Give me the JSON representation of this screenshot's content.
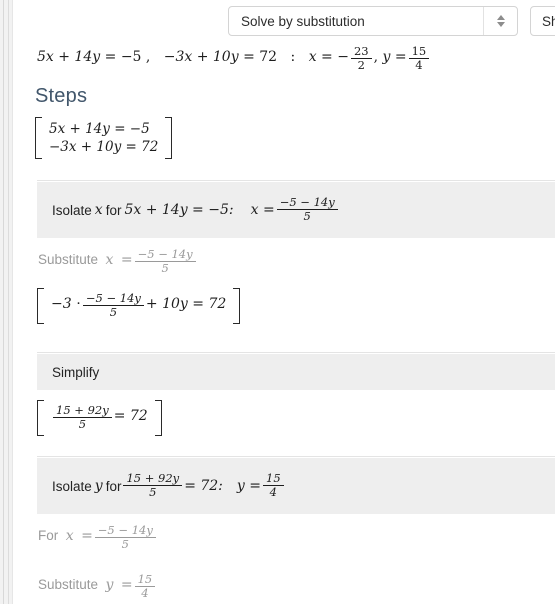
{
  "toolbar": {
    "method_select": {
      "value": "Solve by substitution",
      "stepper_up_icon": "triangle-up-icon",
      "stepper_down_icon": "triangle-down-icon"
    },
    "show_button_label": "Sho"
  },
  "query": {
    "eq1_lhs": "5x + 14y",
    "eq1_rhs": "−5",
    "eq2_lhs": "−3x + 10y",
    "eq2_rhs": "72",
    "separator": ":",
    "sol_x_label": "x =",
    "sol_x_sign": "−",
    "sol_x_num": "23",
    "sol_x_den": "2",
    "sol_y_label": "y =",
    "sol_y_num": "15",
    "sol_y_den": "4",
    "comma": ","
  },
  "steps": {
    "heading": "Steps",
    "system": {
      "row1": "5x + 14y =  −5",
      "row2": "−3x + 10y = 72"
    },
    "items": [
      {
        "kind": "band",
        "name": "isolate-x-step",
        "prefix": "Isolate",
        "var": "x",
        "mid": "for",
        "equation": "5x + 14y = −5:",
        "result_label": "x =",
        "result_num": "−5 − 14y",
        "result_den": "5"
      },
      {
        "kind": "plain",
        "name": "substitute-x-step",
        "prefix": "Substitute",
        "var": "x",
        "eq": "=",
        "num": "−5 − 14y",
        "den": "5"
      },
      {
        "kind": "bracket",
        "name": "substituted-equation",
        "lead": "−3 ⋅",
        "num": "−5 − 14y",
        "den": "5",
        "tail": "+ 10y = 72"
      },
      {
        "kind": "band",
        "name": "simplify-step",
        "label": "Simplify"
      },
      {
        "kind": "bracket",
        "name": "simplified-equation",
        "num": "15 + 92y",
        "den": "5",
        "tail": "= 72"
      },
      {
        "kind": "band",
        "name": "isolate-y-step",
        "prefix": "Isolate",
        "var": "y",
        "mid": "for",
        "frac_num": "15 + 92y",
        "frac_den": "5",
        "equation_tail": "= 72:",
        "result_label": "y =",
        "result_num": "15",
        "result_den": "4"
      },
      {
        "kind": "plain",
        "name": "for-x-step",
        "prefix": "For",
        "var": "x",
        "eq": "=",
        "num": "−5 − 14y",
        "den": "5"
      },
      {
        "kind": "plain",
        "name": "substitute-y-step",
        "prefix": "Substitute",
        "var": "y",
        "eq": "=",
        "num": "15",
        "den": "4"
      }
    ]
  },
  "colors": {
    "band_background": "#eeeeee",
    "heading": "#41566b",
    "muted_text": "#9a9a9a",
    "body_text": "#232323",
    "divider": "#e4e4e4",
    "gutter": "#f2f2f2"
  }
}
